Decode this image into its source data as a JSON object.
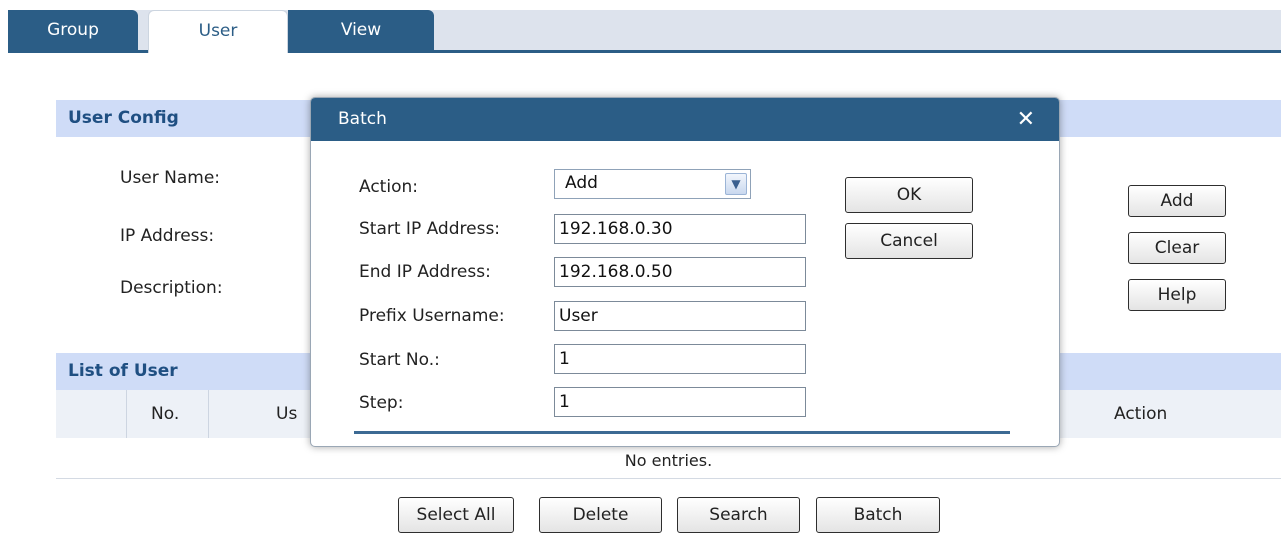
{
  "tabs": {
    "group": "Group",
    "user": "User",
    "view": "View"
  },
  "user_config": {
    "header": "User Config",
    "labels": {
      "user_name": "User Name:",
      "ip_address": "IP Address:",
      "description": "Description:"
    },
    "buttons": {
      "add": "Add",
      "clear": "Clear",
      "help": "Help"
    }
  },
  "list_of_user": {
    "header": "List of User",
    "columns": {
      "no": "No.",
      "user_partial": "Us",
      "action": "Action"
    },
    "empty": "No entries."
  },
  "bottom_buttons": {
    "select_all": "Select All",
    "delete": "Delete",
    "search": "Search",
    "batch": "Batch"
  },
  "batch_dialog": {
    "title": "Batch",
    "close_icon": "close-icon",
    "labels": {
      "action": "Action:",
      "start_ip": "Start IP Address:",
      "end_ip": "End IP Address:",
      "prefix": "Prefix Username:",
      "start_no": "Start No.:",
      "step": "Step:"
    },
    "values": {
      "action": "Add",
      "start_ip": "192.168.0.30",
      "end_ip": "192.168.0.50",
      "prefix": "User",
      "start_no": "1",
      "step": "1"
    },
    "buttons": {
      "ok": "OK",
      "cancel": "Cancel"
    }
  },
  "colors": {
    "accent": "#2b5d86",
    "section_header_bg": "#cfdcf7",
    "section_header_text": "#1f4f82"
  }
}
